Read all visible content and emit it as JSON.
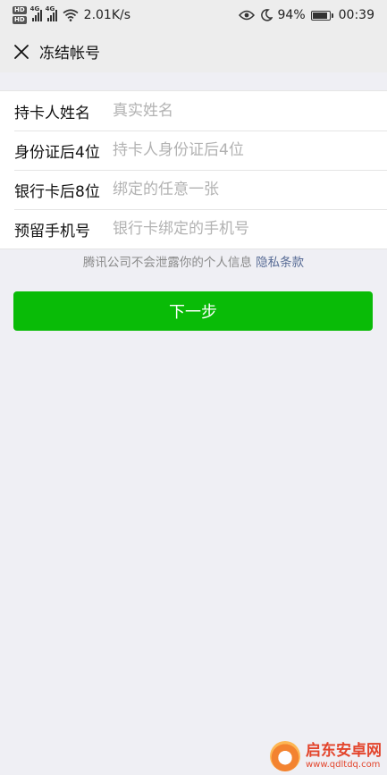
{
  "status_bar": {
    "hd1": "HD",
    "hd2": "HD",
    "net1": "4G",
    "net2": "4G",
    "speed": "2.01K/s",
    "battery_pct": "94%",
    "time": "00:39"
  },
  "header": {
    "title": "冻结帐号"
  },
  "form": {
    "rows": [
      {
        "label": "持卡人姓名",
        "placeholder": "真实姓名"
      },
      {
        "label": "身份证后4位",
        "placeholder": "持卡人身份证后4位"
      },
      {
        "label": "银行卡后8位",
        "placeholder": "绑定的任意一张"
      },
      {
        "label": "预留手机号",
        "placeholder": "银行卡绑定的手机号"
      }
    ]
  },
  "privacy": {
    "text": "腾讯公司不会泄露你的个人信息 ",
    "link": "隐私条款"
  },
  "next_button": {
    "label": "下一步"
  },
  "watermark": {
    "title": "启东安卓网",
    "url": "www.qdltdq.com"
  },
  "colors": {
    "primary_button": "#09bb07",
    "link": "#576b95",
    "background": "#efeff4"
  }
}
